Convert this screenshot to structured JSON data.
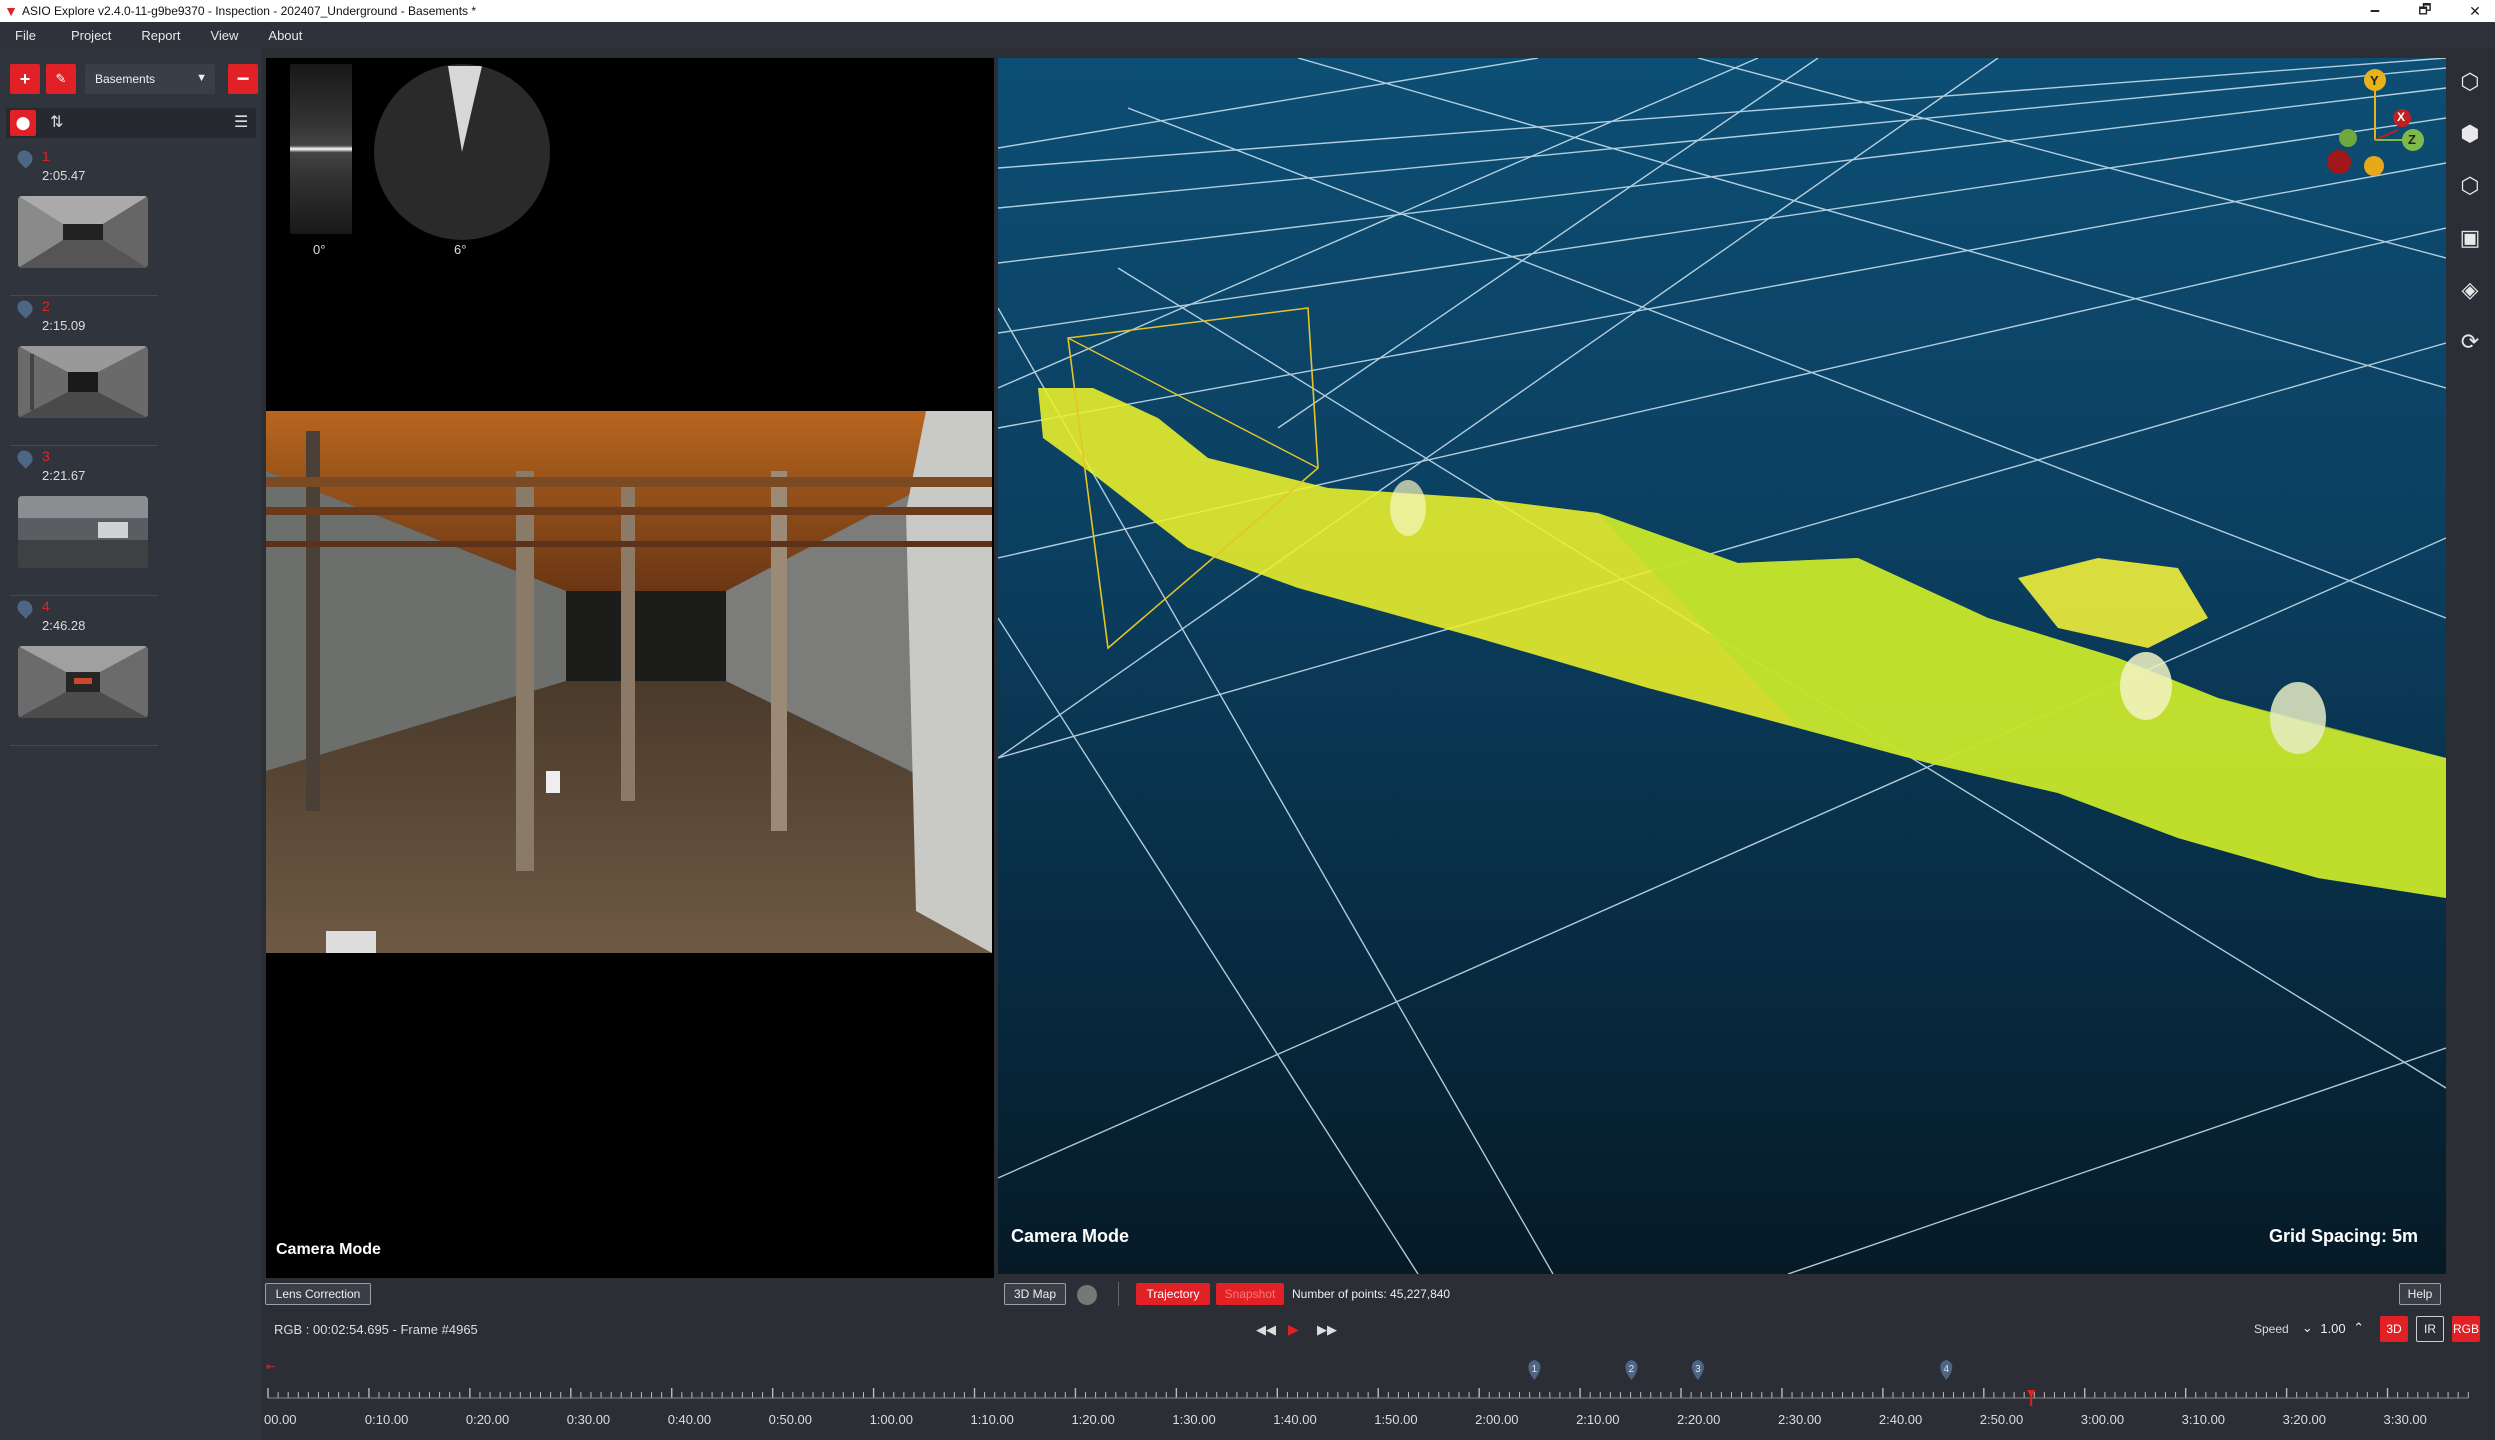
{
  "window": {
    "title": "ASIO Explore v2.4.0-11-g9be9370 - Inspection - 202407_Underground - Basements *",
    "minimize": "🗕",
    "maximize": "🗗",
    "close": "✕"
  },
  "menu": [
    "File",
    "Project",
    "Report",
    "View",
    "About"
  ],
  "left_panel": {
    "folder": "Basements",
    "markers": [
      {
        "num": "1",
        "time": "2:05.47"
      },
      {
        "num": "2",
        "time": "2:15.09"
      },
      {
        "num": "3",
        "time": "2:21.67"
      },
      {
        "num": "4",
        "time": "2:46.28"
      }
    ]
  },
  "camera": {
    "pitch_label": "0°",
    "roll_label": "6°",
    "mode": "Camera Mode",
    "lens_button": "Lens Correction"
  },
  "view3d": {
    "mode": "Camera Mode",
    "grid_spacing": "Grid Spacing: 5m",
    "axes": {
      "y": "Y",
      "x": "X",
      "z": "Z"
    },
    "map_button": "3D Map",
    "trajectory_button": "Trajectory",
    "snapshot_button": "Snapshot",
    "points": "Number of points: 45,227,840",
    "help": "Help"
  },
  "playback": {
    "status": "RGB : 00:02:54.695 - Frame #4965",
    "speed_label": "Speed",
    "speed_value": "1.00",
    "mode_3d": "3D",
    "mode_ir": "IR",
    "mode_rgb": "RGB"
  },
  "timeline": {
    "ticks": [
      "00.00",
      "0:10.00",
      "0:20.00",
      "0:30.00",
      "0:40.00",
      "0:50.00",
      "1:00.00",
      "1:10.00",
      "1:20.00",
      "1:30.00",
      "1:40.00",
      "1:50.00",
      "2:00.00",
      "2:10.00",
      "2:20.00",
      "2:30.00",
      "2:40.00",
      "2:50.00",
      "3:00.00",
      "3:10.00",
      "3:20.00",
      "3:30.00"
    ],
    "marker_pins": [
      {
        "label": "1",
        "time_s": 125.47
      },
      {
        "label": "2",
        "time_s": 135.09
      },
      {
        "label": "3",
        "time_s": 141.67
      },
      {
        "label": "4",
        "time_s": 166.28
      }
    ],
    "playhead_s": 174.695
  },
  "colors": {
    "accent": "#e22127",
    "pin": "#4d6684",
    "pointcloud": "#e6ef2a",
    "axis_y": "#e8b21a",
    "axis_x": "#c0201f",
    "axis_z": "#7fb94a"
  }
}
